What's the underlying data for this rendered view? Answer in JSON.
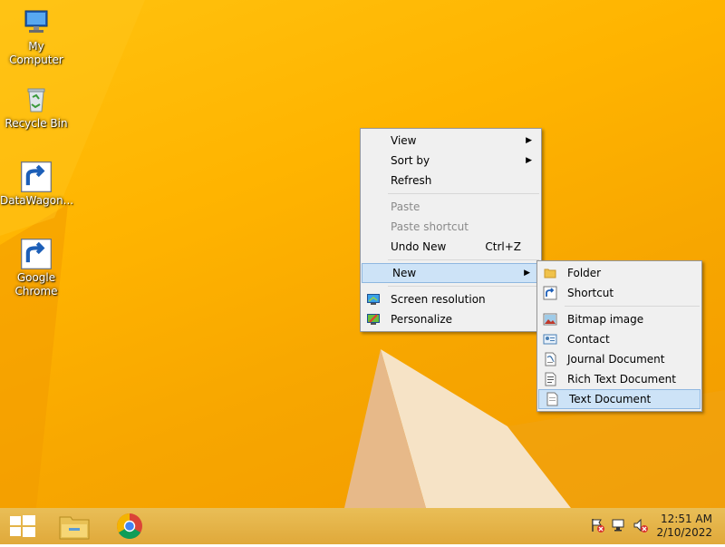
{
  "desktop": {
    "icons": [
      {
        "label": "My Computer",
        "icon": "computer-icon"
      },
      {
        "label": "Recycle Bin",
        "icon": "recycle-bin-icon"
      },
      {
        "label": "DataWagon...",
        "icon": "datawagon-icon"
      },
      {
        "label_line1": "Google",
        "label_line2": "Chrome",
        "icon": "chrome-icon"
      }
    ]
  },
  "context_menu": {
    "view": "View",
    "sort_by": "Sort by",
    "refresh": "Refresh",
    "paste": "Paste",
    "paste_shortcut": "Paste shortcut",
    "undo_new": "Undo New",
    "undo_new_shortcut": "Ctrl+Z",
    "new": "New",
    "screen_resolution": "Screen resolution",
    "personalize": "Personalize"
  },
  "new_submenu": {
    "folder": "Folder",
    "shortcut": "Shortcut",
    "bitmap_image": "Bitmap image",
    "contact": "Contact",
    "journal_document": "Journal Document",
    "rich_text_document": "Rich Text Document",
    "text_document": "Text Document"
  },
  "taskbar": {
    "pinned": [
      "start-icon",
      "file-explorer-icon",
      "chrome-icon"
    ],
    "tray_icons": [
      "action-center-flag-icon",
      "network-icon",
      "volume-muted-icon"
    ],
    "time": "12:51 AM",
    "date": "2/10/2022"
  },
  "colors": {
    "desktop_accent": "#ffb400",
    "menu_highlight": "#cde3f7",
    "taskbar": "#e0a93a"
  }
}
